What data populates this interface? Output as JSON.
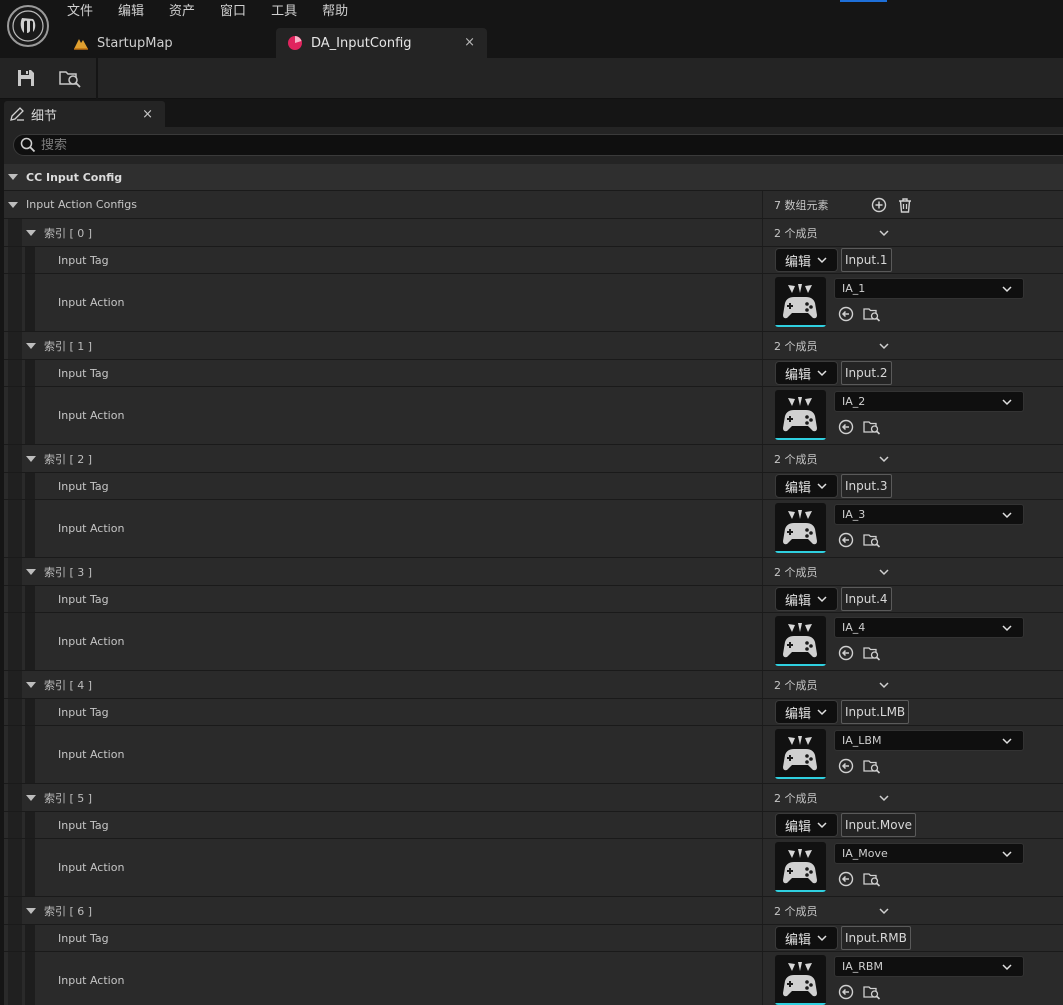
{
  "menu": [
    "文件",
    "编辑",
    "资产",
    "窗口",
    "工具",
    "帮助"
  ],
  "tabs": {
    "map": "StartupMap",
    "asset": "DA_InputConfig",
    "close_glyph": "×"
  },
  "details_tab": {
    "label": "细节",
    "close_glyph": "×"
  },
  "search": {
    "placeholder": "搜索"
  },
  "category": {
    "label": "CC Input Config"
  },
  "array": {
    "label": "Input Action Configs",
    "count": "7 数组元素"
  },
  "row_labels": {
    "members": "2 个成员",
    "input_tag": "Input Tag",
    "input_action": "Input Action",
    "edit_button": "编辑"
  },
  "elements": [
    {
      "index_label": "索引 [ 0 ]",
      "tag": "Input.1",
      "action": "IA_1"
    },
    {
      "index_label": "索引 [ 1 ]",
      "tag": "Input.2",
      "action": "IA_2"
    },
    {
      "index_label": "索引 [ 2 ]",
      "tag": "Input.3",
      "action": "IA_3"
    },
    {
      "index_label": "索引 [ 3 ]",
      "tag": "Input.4",
      "action": "IA_4"
    },
    {
      "index_label": "索引 [ 4 ]",
      "tag": "Input.LMB",
      "action": "IA_LBM"
    },
    {
      "index_label": "索引 [ 5 ]",
      "tag": "Input.Move",
      "action": "IA_Move"
    },
    {
      "index_label": "索引 [ 6 ]",
      "tag": "Input.RMB",
      "action": "IA_RBM"
    }
  ],
  "colors": {
    "accent_blue": "#1e6fd8",
    "thumb_underline": "#2fd0e0",
    "asset_tab_icon": "#e0245e",
    "map_tab_icon": "#e0a030"
  },
  "icons": {
    "logo": "unreal-logo-icon",
    "save": "save-icon",
    "browse": "content-browser-icon",
    "details": "pencil-icon",
    "search": "search-icon",
    "add": "add-element-icon",
    "clear": "trash-icon",
    "use_selected": "use-selected-icon",
    "browse_asset": "browse-asset-icon",
    "thumbnail": "gamepad-icon"
  }
}
